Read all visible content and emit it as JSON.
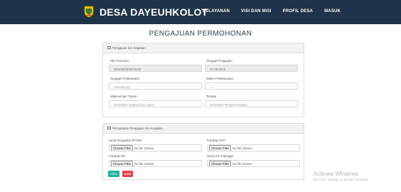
{
  "brand": {
    "title": "DESA DAYEUHKOLOT"
  },
  "nav": {
    "items": [
      "PELAYANAN",
      "VISI DAN MISI",
      "PROFIL DESA",
      "MASUK"
    ]
  },
  "page": {
    "title": "PENGAJUAN PERMOHONAN"
  },
  "request_card": {
    "header": "Pengajuan Izin Kegiatan",
    "nik_label": "NIK Pemohon",
    "nik_value": "3204080305970030",
    "date_request_label": "Tanggal Pengajuan",
    "date_request_value": "01-08-2019",
    "date_event_label": "Tanggal Pelaksanaan",
    "date_event_placeholder": "mm/dd/yyyy",
    "time_label": "Waktu Pelaksanaan",
    "time_placeholder": "--:--",
    "purpose_label": "Maksud dan Tujuan",
    "purpose_placeholder": "Masukkan maksud dan tujuan",
    "place_label": "Tempat",
    "place_placeholder": "Masukkan Tempat Kegiatan"
  },
  "requirements_card": {
    "header": "Persyaratan Pengajuan Izin Kegiatan",
    "choose_files_label": "Choose Files",
    "no_file_text": "No file chosen",
    "fields": [
      {
        "label": "Surat Pengantar RT/RW"
      },
      {
        "label": "Fotokopi KTP"
      },
      {
        "label": "Fotokopi KK"
      },
      {
        "label": "Surat Izin Tetangga"
      }
    ],
    "submit_label": "Kirim",
    "cancel_label": "Batal"
  },
  "watermark": {
    "title": "Activate Windows",
    "subtitle": "Go to PC settings to activate Windows."
  },
  "colors": {
    "navbar": "#1f3448",
    "submit": "#1fb3a0",
    "cancel": "#e0414d"
  }
}
